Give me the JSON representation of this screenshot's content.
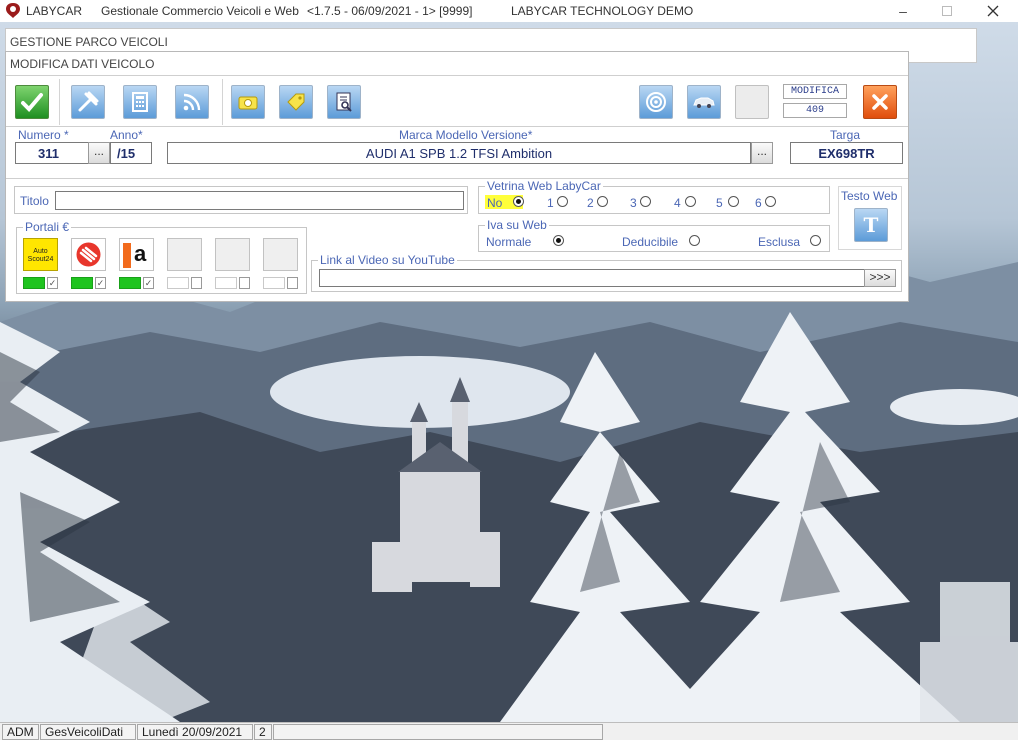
{
  "titlebar": {
    "app_name": "LABYCAR",
    "subtitle": "Gestionale Commercio Veicoli e Web",
    "version": "<1.7.5 - 06/09/2021 - 1> [9999]",
    "edition": "LABYCAR TECHNOLOGY DEMO"
  },
  "parent_window": {
    "title": "GESTIONE PARCO VEICOLI"
  },
  "dialog": {
    "title": "MODIFICA DATI VEICOLO",
    "mode_label": "MODIFICA",
    "record_id": "409"
  },
  "vehicle": {
    "numero_label": "Numero *",
    "numero": "311",
    "anno_label": "Anno*",
    "anno": "/15",
    "marca_label": "Marca Modello Versione*",
    "marca": "AUDI A1 SPB 1.2 TFSI Ambition",
    "targa_label": "Targa",
    "targa": "EX698TR",
    "dots": "..."
  },
  "titolo": {
    "label": "Titolo",
    "value": ""
  },
  "vetrina": {
    "legend": "Vetrina Web LabyCar",
    "options": [
      "No",
      "1",
      "2",
      "3",
      "4",
      "5",
      "6"
    ],
    "selected": "No"
  },
  "iva": {
    "legend": "Iva su Web",
    "options": [
      "Normale",
      "Deducibile",
      "Esclusa"
    ],
    "selected": "Normale"
  },
  "testo_web": {
    "label": "Testo Web",
    "icon_letter": "T"
  },
  "portali": {
    "legend": "Portali €",
    "autoscout_line1": "Auto",
    "autoscout_line2": "Scout24",
    "subito_letter": "a"
  },
  "video": {
    "legend": "Link al Video su YouTube",
    "value": "",
    "go_label": ">>>"
  },
  "statusbar": {
    "user": "ADM",
    "form": "GesVeicoliDati",
    "date": "Lunedì 20/09/2021",
    "count": "2"
  },
  "colors": {
    "accent_blue": "#4b67b5",
    "value_blue": "#1f2e6b",
    "active_green": "#1fc41f",
    "highlight_yellow": "#ffff3a"
  }
}
